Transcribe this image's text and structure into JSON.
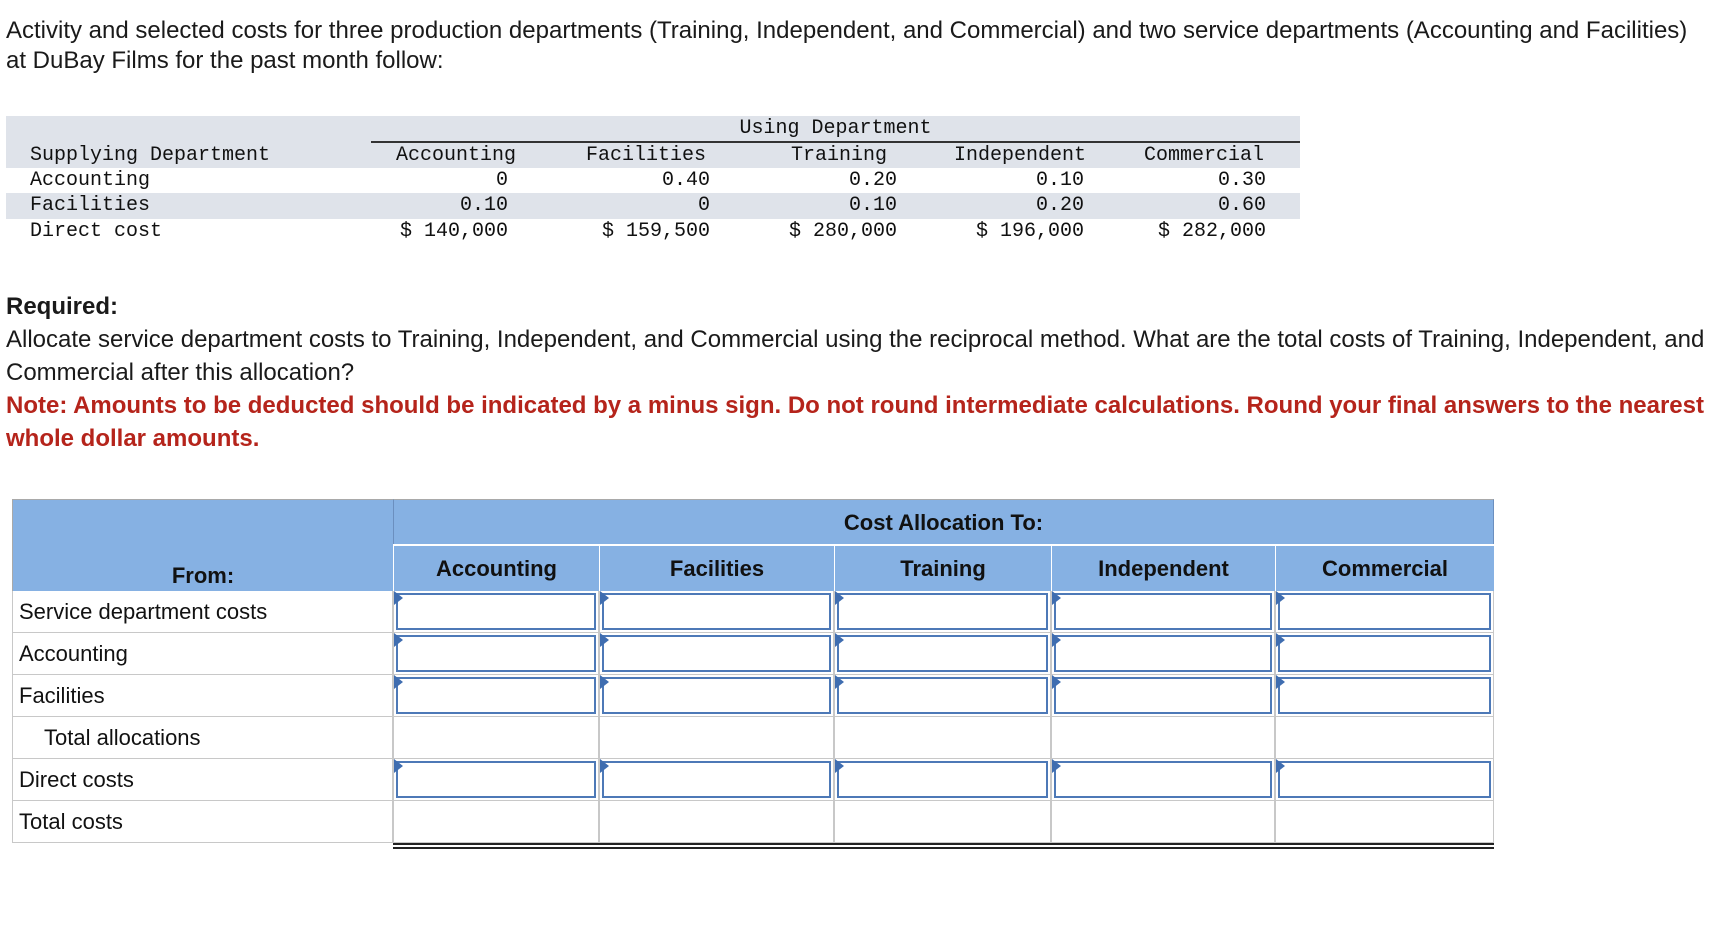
{
  "intro": "Activity and selected costs for three production departments (Training, Independent, and Commercial) and two service departments (Accounting and Facilities) at DuBay Films for the past month follow:",
  "data_table": {
    "group_header": "Using Department",
    "row_header_label": "Supplying Department",
    "columns": [
      "Accounting",
      "Facilities",
      "Training",
      "Independent",
      "Commercial"
    ],
    "rows": [
      {
        "label": "Accounting",
        "values": [
          "0",
          "0.40",
          "0.20",
          "0.10",
          "0.30"
        ]
      },
      {
        "label": "Facilities",
        "values": [
          "0.10",
          "0",
          "0.10",
          "0.20",
          "0.60"
        ]
      },
      {
        "label": "Direct cost",
        "values": [
          "$ 140,000",
          "$ 159,500",
          "$ 280,000",
          "$ 196,000",
          "$ 282,000"
        ]
      }
    ]
  },
  "required": {
    "heading": "Required:",
    "text": "Allocate service department costs to Training, Independent, and Commercial using the reciprocal method. What are the total costs of Training, Independent, and Commercial after this allocation?",
    "note": "Note: Amounts to be deducted should be indicated by a minus sign. Do not round intermediate calculations. Round your final answers to the nearest whole dollar amounts."
  },
  "answer_table": {
    "group_header": "Cost Allocation To:",
    "from_label": "From:",
    "columns": [
      "Accounting",
      "Facilities",
      "Training",
      "Independent",
      "Commercial"
    ],
    "rows": [
      {
        "label": "Service department costs",
        "inputs": true,
        "indent": false
      },
      {
        "label": "Accounting",
        "inputs": true,
        "indent": false
      },
      {
        "label": "Facilities",
        "inputs": true,
        "indent": false
      },
      {
        "label": "Total allocations",
        "inputs": false,
        "indent": true
      },
      {
        "label": "Direct costs",
        "inputs": true,
        "indent": false
      },
      {
        "label": "Total costs",
        "inputs": false,
        "indent": false
      }
    ],
    "values": [
      [
        "",
        "",
        "",
        "",
        ""
      ],
      [
        "",
        "",
        "",
        "",
        ""
      ],
      [
        "",
        "",
        "",
        "",
        ""
      ],
      [
        "",
        "",
        "",
        "",
        ""
      ],
      [
        "",
        "",
        "",
        "",
        ""
      ],
      [
        "",
        "",
        "",
        "",
        ""
      ]
    ]
  },
  "colors": {
    "header_blue": "#86b1e3",
    "note_red": "#b5241b",
    "input_border": "#4d79b7"
  }
}
